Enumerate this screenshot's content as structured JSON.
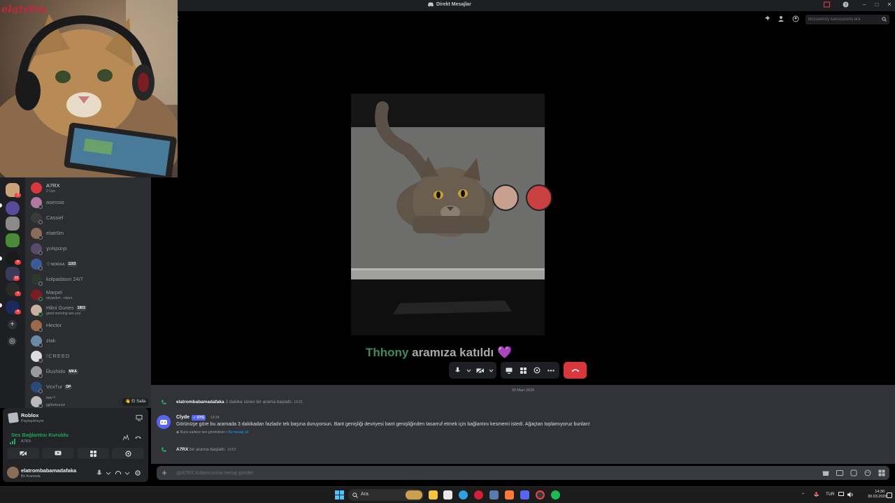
{
  "window": {
    "title": "Direkt Mesajlar"
  },
  "webcam": {
    "label": "elatr0m"
  },
  "guilds": {
    "badges": [
      "3",
      "4",
      "10",
      "4",
      "4"
    ]
  },
  "members": {
    "group": {
      "name": "A7RX",
      "sub": "2 Üye"
    },
    "items": [
      {
        "name": "asensio",
        "sub": "",
        "tag": ""
      },
      {
        "name": "Cassiel",
        "sub": "",
        "tag": ""
      },
      {
        "name": "elatr0m",
        "sub": "",
        "tag": ""
      },
      {
        "name": "ɣʊɫɪʂɑɳɑ",
        "sub": "",
        "tag": ""
      },
      {
        "name": "☆ɴᴏʀᴀᴀ",
        "sub": "",
        "tag": "1103"
      },
      {
        "name": "kolpadasın 24/7",
        "sub": "",
        "tag": ""
      },
      {
        "name": "Marpel",
        "sub": "miyardım - mipro",
        "tag": ""
      },
      {
        "name": "Hâni Gunes",
        "sub": "good morning see you",
        "tag": "1903"
      },
      {
        "name": "Hector",
        "sub": "",
        "tag": ""
      },
      {
        "name": "ziak",
        "sub": "",
        "tag": ""
      },
      {
        "name": "!CREED",
        "sub": "",
        "tag": ""
      },
      {
        "name": "ᗷushido",
        "sub": "",
        "tag": "MKA"
      },
      {
        "name": "Vєx†ur",
        "sub": "",
        "tag": "DP"
      },
      {
        "name": "twiv™",
        "sub": "gg/botcunuz",
        "tag": ""
      }
    ],
    "wave_label": "El Salla"
  },
  "voice_panel": {
    "activity_title": "Roblox",
    "activity_sub": "Paylaşılmıyor",
    "state": "Ses Bağlantısı Kuruldu",
    "state_sub": "A7RX",
    "user_name": "elatrombabamadafaka",
    "user_sub": "Bir Aramada"
  },
  "call": {
    "search_placeholder": "901swenzy sunucusunu ara",
    "joined_name": "Thhony",
    "joined_rest": " aramıza katıldı ",
    "joined_heart": "💜"
  },
  "chat": {
    "date": "30 Mart 2026",
    "messages": [
      {
        "author": "elatrombabamadafaka",
        "text": "3 dakika süren bir arama başlattı.",
        "time": "13:21"
      },
      {
        "author": "A7RX",
        "text": "bir arama başlattı.",
        "time": "13:57"
      }
    ],
    "clyde": {
      "name": "Clyde",
      "badge": "✓ UYG",
      "time": "13:24",
      "text": "Görünüşe göre bu aramada 3 dakikadan fazladır tek başına duruyorsun. Bant genişliği devriyesi bant genişliğinden tasarruf etmek için bağlantını kesmemi istedi. Ağaçtan toplamıyoruz bunları!",
      "note": "Bunu sadece sen görebilirsin •",
      "note_link": "Bu mesajı sil"
    },
    "composer_placeholder": "@A7RX kullanıcısına mesaj gönder"
  },
  "taskbar": {
    "search_label": "Ara",
    "lang": "TUR",
    "time": "14:30",
    "date": "30.03.2026"
  },
  "colors": {
    "accent": "#5865f2",
    "hangup": "#da373c",
    "online": "#23a55a"
  }
}
